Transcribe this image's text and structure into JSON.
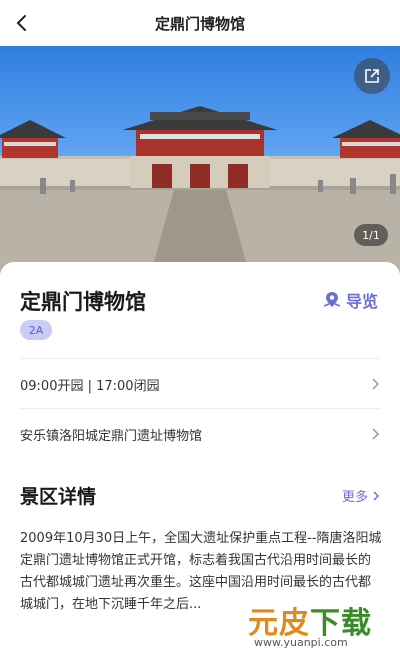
{
  "nav": {
    "title": "定鼎门博物馆",
    "back_icon": "chevron-left-icon"
  },
  "hero": {
    "alt_subject": "",
    "counter": "1/1",
    "share_icon": "share-icon"
  },
  "card": {
    "name": "定鼎门博物馆",
    "guide_label": "导览",
    "rating": "2A",
    "hours": "09:00开园 | 17:00闭园",
    "address": "安乐镇洛阳城定鼎门遗址博物馆",
    "section_title": "景区详情",
    "more_label": "更多",
    "description": "2009年10月30日上午，全国大遗址保护重点工程--隋唐洛阳城定鼎门遗址博物馆正式开馆，标志着我国古代沿用时间最长的古代都城城门遗址再次重生。这座中国沿用时间最长的古代都城城门，在地下沉睡千年之后..."
  },
  "watermark": {
    "brand_part1": "元",
    "brand_part2": "皮",
    "brand_part3": "下载",
    "url": "www.yuanpi.com"
  },
  "colors": {
    "accent": "#6a6fd6",
    "badge_bg": "#c9ccf4"
  }
}
